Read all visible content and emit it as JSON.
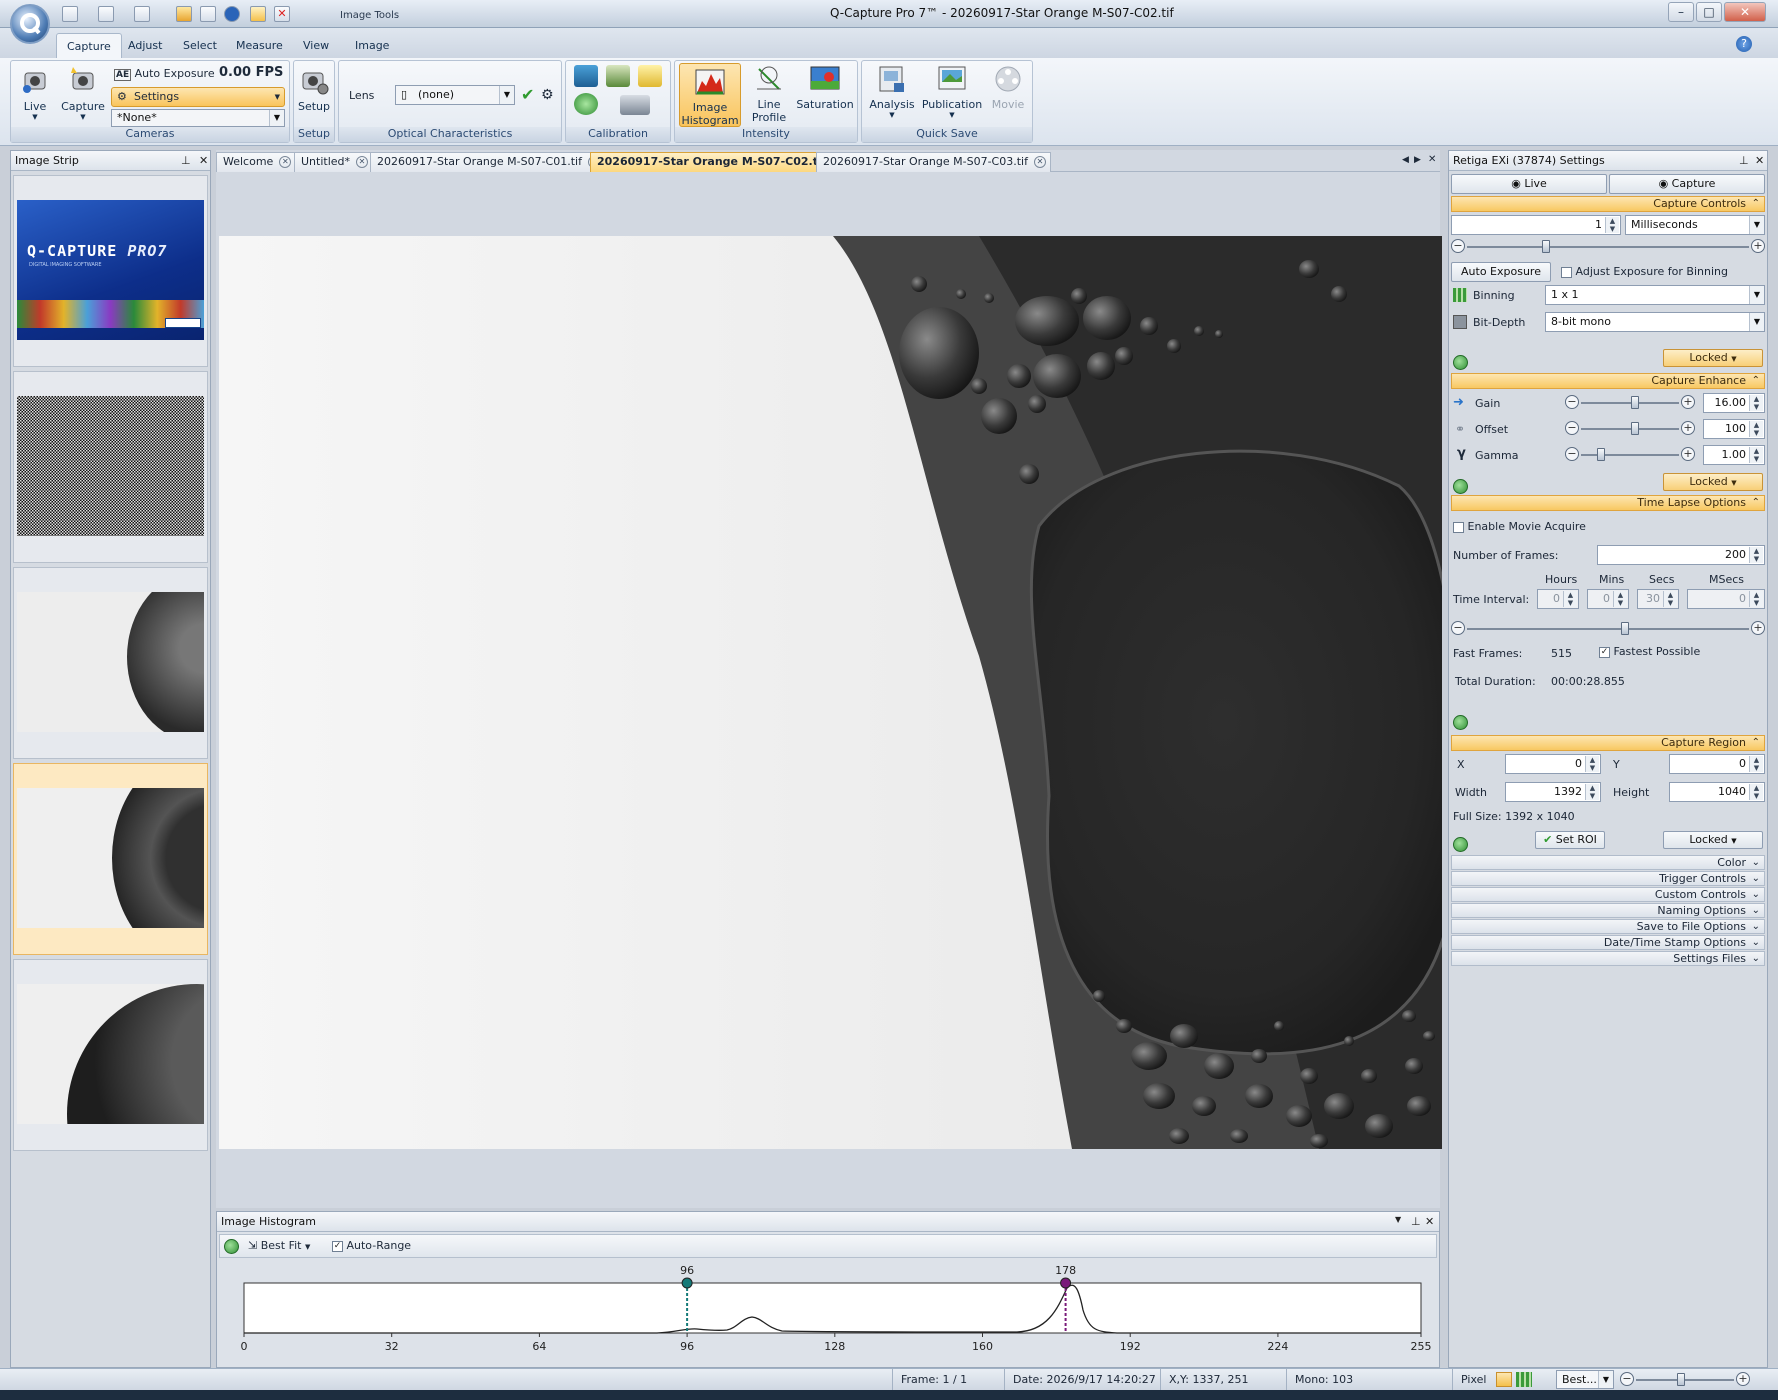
{
  "app": {
    "window_title": "Q-Capture Pro 7™ - 20260917-Star Orange M-S07-C02.tif",
    "contextual_tab": "Image Tools"
  },
  "ribbon": {
    "tabs": [
      "Capture",
      "Adjust",
      "Select",
      "Measure",
      "View",
      "Image"
    ],
    "active_tab": "Capture",
    "cameras": {
      "live": "Live",
      "capture": "Capture",
      "auto_exposure": "Auto Exposure",
      "fps": "0.00 FPS",
      "settings": "Settings",
      "preset": "*None*",
      "group_label": "Cameras"
    },
    "setup": {
      "button": "Setup",
      "group_label": "Setup"
    },
    "optical": {
      "lens_label": "Lens",
      "lens_value": "(none)",
      "group_label": "Optical Characteristics"
    },
    "calibration": {
      "group_label": "Calibration"
    },
    "intensity": {
      "image_histogram": [
        "Image",
        "Histogram"
      ],
      "line_profile": [
        "Line",
        "Profile"
      ],
      "saturation": "Saturation",
      "group_label": "Intensity"
    },
    "quick_save": {
      "analysis": "Analysis",
      "publication": "Publication",
      "movie": "Movie",
      "group_label": "Quick Save"
    }
  },
  "image_strip": {
    "title": "Image Strip",
    "splash": {
      "brand": "Q-CAPTURE",
      "version": "PRO7",
      "tagline": "DIGITAL IMAGING SOFTWARE"
    }
  },
  "document_tabs": [
    {
      "label": "Welcome",
      "active": false
    },
    {
      "label": "Untitled*",
      "active": false
    },
    {
      "label": "20260917-Star Orange M-S07-C01.tif",
      "active": false
    },
    {
      "label": "20260917-Star Orange M-S07-C02.tif",
      "active": true
    },
    {
      "label": "20260917-Star Orange M-S07-C03.tif",
      "active": false
    }
  ],
  "histogram": {
    "title": "Image Histogram",
    "fit_mode": "Best Fit",
    "auto_range_label": "Auto-Range",
    "auto_range_checked": true,
    "low_marker": 96,
    "high_marker": 178,
    "axis_ticks": [
      "0",
      "32",
      "64",
      "96",
      "128",
      "160",
      "192",
      "224",
      "255"
    ],
    "marker_low_color": "#157a78",
    "marker_high_color": "#7a1a7a"
  },
  "status_bar": {
    "frame": "Frame: 1 / 1",
    "date": "Date: 2026/9/17 14:20:27",
    "xy": "X,Y: 1337,  251",
    "mono": "Mono:  103",
    "units": "Pixel",
    "zoom": "Best..."
  },
  "settings": {
    "title": "Retiga EXi (37874) Settings",
    "live_tab": "Live",
    "capture_tab": "Capture",
    "capture_controls": {
      "header": "Capture Controls",
      "exposure_value": "1",
      "exposure_unit": "Milliseconds",
      "exposure_slider_fraction": 0.28,
      "auto_exposure_button": "Auto Exposure",
      "adjust_binning_label": "Adjust Exposure for Binning",
      "adjust_binning_checked": false,
      "binning_label": "Binning",
      "binning_value": "1 x 1",
      "bitdepth_label": "Bit-Depth",
      "bitdepth_value": "8-bit mono",
      "locked": "Locked"
    },
    "capture_enhance": {
      "header": "Capture Enhance",
      "gain_label": "Gain",
      "gain_value": "16.00",
      "gain_slider_fraction": 0.55,
      "offset_label": "Offset",
      "offset_value": "100",
      "offset_slider_fraction": 0.55,
      "gamma_label": "Gamma",
      "gamma_value": "1.00",
      "gamma_slider_fraction": 0.2,
      "locked": "Locked"
    },
    "time_lapse": {
      "header": "Time Lapse Options",
      "enable_movie_label": "Enable Movie Acquire",
      "enable_movie_checked": false,
      "frames_label": "Number of  Frames:",
      "frames_value": "200",
      "col_hours": "Hours",
      "col_mins": "Mins",
      "col_secs": "Secs",
      "col_msecs": "MSecs",
      "interval_label": "Time Interval:",
      "hours": "0",
      "mins": "0",
      "secs": "30",
      "msecs": "0",
      "interval_slider_fraction": 0.56,
      "fast_frames_label": "Fast Frames:",
      "fast_frames_value": "515",
      "fastest_label": "Fastest Possible",
      "fastest_checked": true,
      "duration_label": "Total Duration:",
      "duration_value": "00:00:28.855"
    },
    "capture_region": {
      "header": "Capture Region",
      "x_label": "X",
      "x_value": "0",
      "y_label": "Y",
      "y_value": "0",
      "width_label": "Width",
      "width_value": "1392",
      "height_label": "Height",
      "height_value": "1040",
      "full_size": "Full Size: 1392 x 1040",
      "set_roi": "Set ROI",
      "locked": "Locked"
    },
    "collapsed_sections": [
      "Color",
      "Trigger Controls",
      "Custom Controls",
      "Naming Options",
      "Save to File Options",
      "Date/Time Stamp Options",
      "Settings Files"
    ]
  }
}
